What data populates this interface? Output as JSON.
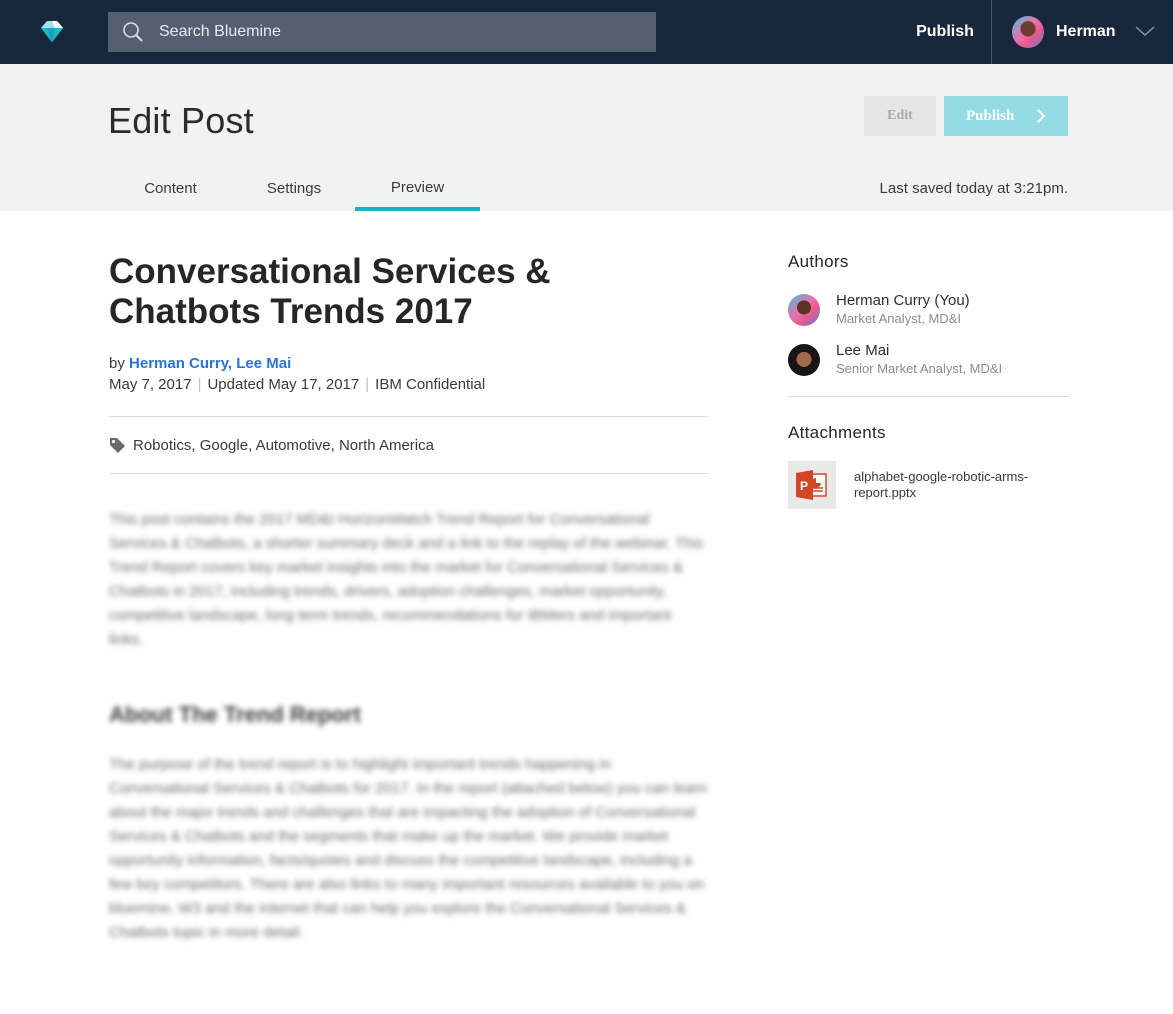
{
  "nav": {
    "logo": "bluemine-diamond-logo",
    "search_placeholder": "Search Bluemine",
    "publish_label": "Publish",
    "user_name": "Herman"
  },
  "header": {
    "title": "Edit Post",
    "edit_label": "Edit",
    "publish_label": "Publish",
    "last_saved": "Last saved today at 3:21pm.",
    "tabs": [
      {
        "label": "Content",
        "active": false
      },
      {
        "label": "Settings",
        "active": false
      },
      {
        "label": "Preview",
        "active": true
      }
    ]
  },
  "post": {
    "title": "Conversational Services & Chatbots Trends 2017",
    "by_prefix": "by",
    "authors_link": "Herman Curry, Lee Mai",
    "date": "May 7, 2017",
    "updated": "Updated May 17, 2017",
    "classification": "IBM Confidential",
    "tags": "Robotics, Google, Automotive, North America",
    "intro": "This post contains the 2017 MD&I HorizonWatch Trend Report for Conversational Services & Chatbots, a shorter summary deck and a link to the replay of the webinar. This Trend Report covers key market insights into the market for Conversational Services & Chatbots in 2017, including trends, drivers, adoption challenges, market opportunity, competitive landscape, long term trends, recommendations for IBMers and important links.",
    "section_heading": "About The Trend Report",
    "section_body": "The purpose of the trend report is to highlight important trends happening in Conversational Services & Chatbots for 2017. In the report (attached below) you can learn about the major trends and challenges that are impacting the adoption of Conversational Services & Chatbots and the segments that make up the market. We provide market opportunity information, facts/quotes and discuss the competitive landscape, including a few key competitors. There are also links to many important resources available to you on bluemine, W3 and the internet that can help you explore the Conversational Services & Chatbots topic in more detail."
  },
  "sidebar": {
    "authors_heading": "Authors",
    "authors": [
      {
        "name": "Herman Curry (You)",
        "role": "Market Analyst, MD&I"
      },
      {
        "name": "Lee Mai",
        "role": "Senior Market Analyst, MD&I"
      }
    ],
    "attachments_heading": "Attachments",
    "attachments": [
      {
        "file_name": "alphabet-google-robotic-arms-report.pptx",
        "icon": "powerpoint-icon"
      }
    ]
  },
  "colors": {
    "nav_bg": "#19273c",
    "accent": "#1fb0c5",
    "publish_button": "#94dbe4",
    "link": "#2c74d4"
  }
}
